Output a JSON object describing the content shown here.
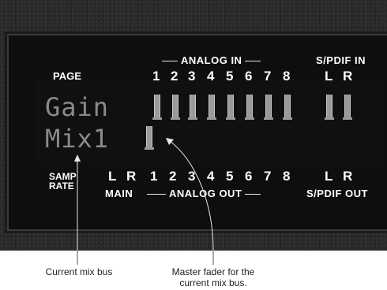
{
  "header": {
    "page_label": "PAGE",
    "analog_in": "ANALOG IN",
    "spdif_in": "S/PDIF IN",
    "input_numbers": [
      "1",
      "2",
      "3",
      "4",
      "5",
      "6",
      "7",
      "8"
    ],
    "spdif_in_channels": [
      "L",
      "R"
    ]
  },
  "display": {
    "line1": "Gain",
    "line2": "Mix1",
    "gain_meters": 10,
    "mix_meters": 1
  },
  "footer": {
    "samp_rate": [
      "SAMP",
      "RATE"
    ],
    "main_channels": [
      "L",
      "R"
    ],
    "output_numbers": [
      "1",
      "2",
      "3",
      "4",
      "5",
      "6",
      "7",
      "8"
    ],
    "spdif_out_channels": [
      "L",
      "R"
    ],
    "main_label": "MAIN",
    "analog_out": "ANALOG OUT",
    "spdif_out": "S/PDIF OUT"
  },
  "callouts": {
    "mix_bus": "Current mix bus",
    "master_fader": [
      "Master fader for the",
      "current mix bus."
    ]
  }
}
